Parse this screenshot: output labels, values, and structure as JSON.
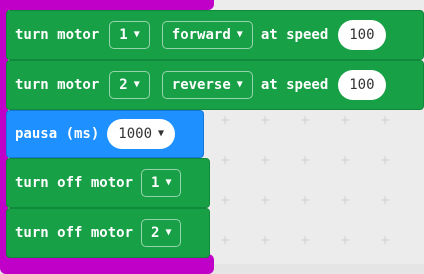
{
  "blocks": [
    {
      "type": "motor",
      "label": "turn motor",
      "motor": "1",
      "direction": "forward",
      "at_label": "at speed",
      "speed": "100"
    },
    {
      "type": "motor",
      "label": "turn motor",
      "motor": "2",
      "direction": "reverse",
      "at_label": "at speed",
      "speed": "100"
    },
    {
      "type": "pause",
      "label": "pausa (ms)",
      "value": "1000"
    },
    {
      "type": "off",
      "label": "turn off motor",
      "motor": "1"
    },
    {
      "type": "off",
      "label": "turn off motor",
      "motor": "2"
    }
  ],
  "icons": {
    "dropdown": "caret-down-icon"
  },
  "colors": {
    "motor_block": "#17a046",
    "pause_block": "#1e90ff",
    "container_block": "#c000c8",
    "workspace": "#ececec"
  }
}
